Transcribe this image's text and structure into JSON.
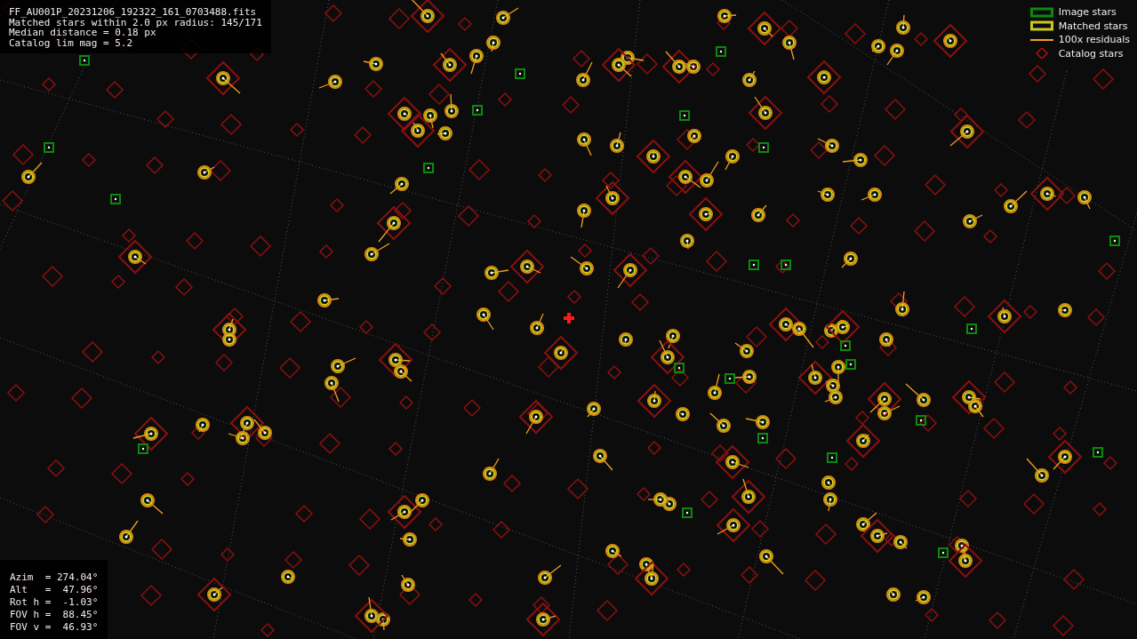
{
  "file_info": [
    "FF_AU001P_20231206_192322_161_0703488.fits",
    "Matched stars within 2.0 px radius: 145/171",
    "Median distance = 0.18 px",
    "Catalog lim mag = 5.2"
  ],
  "legend": [
    {
      "kind": "image",
      "label": "Image stars",
      "color": "#0b8a0b"
    },
    {
      "kind": "matched",
      "label": "Matched stars",
      "color": "#c8c81e"
    },
    {
      "kind": "residual",
      "label": "100x residuals",
      "color": "#f0a020"
    },
    {
      "kind": "catalog",
      "label": "Catalog stars",
      "color": "#b01010"
    }
  ],
  "pointing": [
    "Azim  = 274.04°",
    "Alt   =  47.96°",
    "Rot h =  -1.03°",
    "FOV h =  88.45°",
    "FOV v =  46.93°"
  ]
}
